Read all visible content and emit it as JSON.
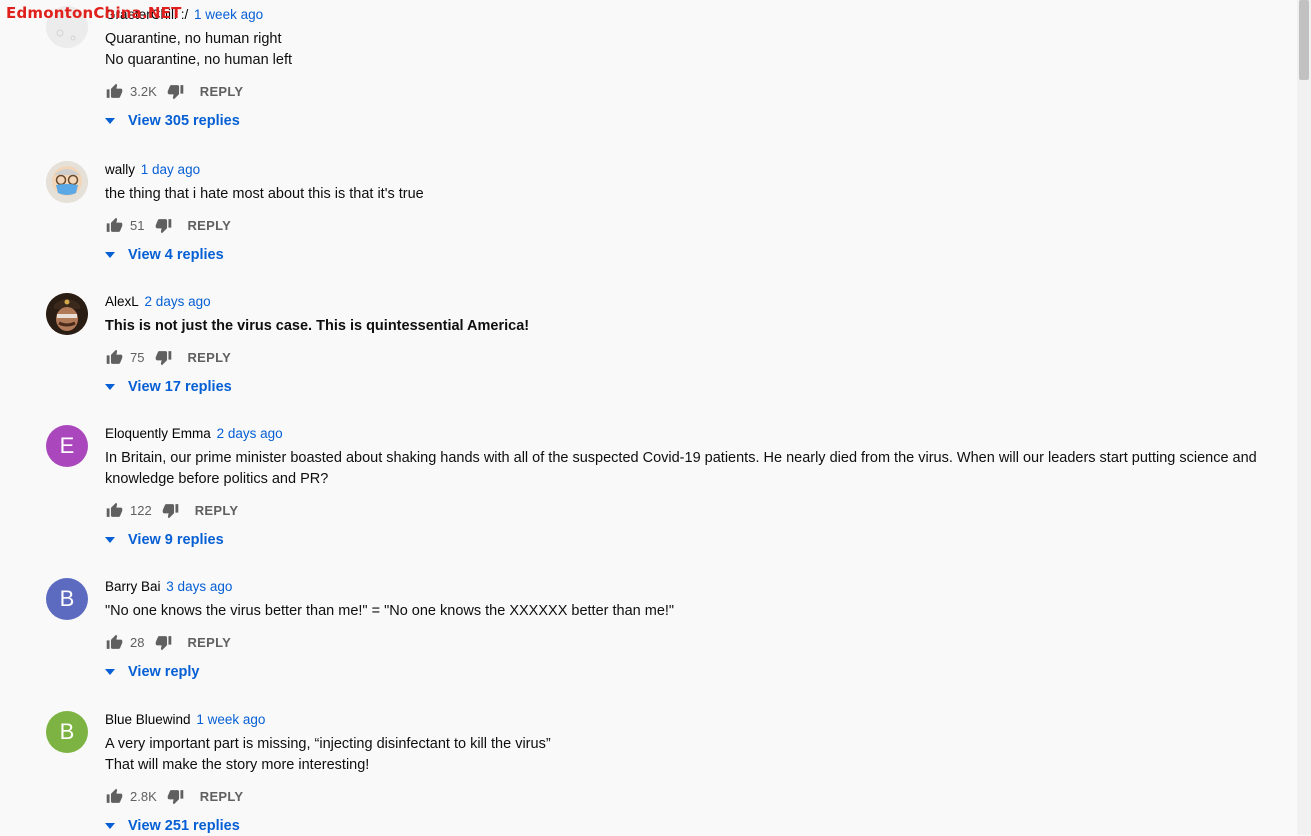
{
  "watermark": "EdmontonChina.NET",
  "comments": [
    {
      "author": "GraeterChill :/",
      "time": "1 week ago",
      "lines": [
        "Quarantine, no human right",
        "No quarantine, no human left"
      ],
      "likes": "3.2K",
      "reply_label": "REPLY",
      "replies_label": "View 305 replies",
      "avatar": {
        "kind": "image",
        "icon": "grey-blank-avatar"
      }
    },
    {
      "author": "wally",
      "time": "1 day ago",
      "lines": [
        "the thing that i hate most about this is that it's true"
      ],
      "likes": "51",
      "reply_label": "REPLY",
      "replies_label": "View 4 replies",
      "avatar": {
        "kind": "image",
        "icon": "masked-face-avatar"
      }
    },
    {
      "author": "AlexL",
      "time": "2 days ago",
      "lines": [
        "This is not just the virus case. This is quintessential America!"
      ],
      "likes": "75",
      "reply_label": "REPLY",
      "replies_label": "View 17 replies",
      "avatar": {
        "kind": "image",
        "icon": "officer-avatar"
      }
    },
    {
      "author": "Eloquently Emma",
      "time": "2 days ago",
      "lines": [
        "In Britain, our prime minister boasted about shaking hands with all of the suspected Covid-19 patients. He nearly died from the virus. When will our leaders start putting science and knowledge before politics and PR?"
      ],
      "likes": "122",
      "reply_label": "REPLY",
      "replies_label": "View 9 replies",
      "avatar": {
        "kind": "letter",
        "letter": "E",
        "color": "#ab47bc"
      }
    },
    {
      "author": "Barry Bai",
      "time": "3 days ago",
      "lines": [
        "\"No one knows the virus better than me!\" = \"No one knows the XXXXXX better than me!\""
      ],
      "likes": "28",
      "reply_label": "REPLY",
      "replies_label": "View reply",
      "avatar": {
        "kind": "letter",
        "letter": "B",
        "color": "#5c6bc0"
      }
    },
    {
      "author": "Blue Bluewind",
      "time": "1 week ago",
      "lines": [
        "A very important part is missing, “injecting disinfectant to kill the virus”",
        "That will make the story more interesting!"
      ],
      "likes": "2.8K",
      "reply_label": "REPLY",
      "replies_label": "View 251 replies",
      "avatar": {
        "kind": "letter",
        "letter": "B",
        "color": "#7cb342"
      }
    }
  ],
  "colors": {
    "link": "#065fd4",
    "muted": "#606060",
    "background": "#f9f9f9"
  }
}
